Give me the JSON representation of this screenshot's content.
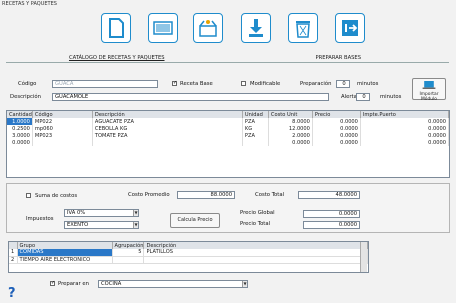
{
  "window": {
    "title": "RECETAS Y PAQUETES"
  },
  "toolbar": {
    "icons": [
      "new-document-icon",
      "barcode-icon",
      "package-icon",
      "download-icon",
      "delete-icon",
      "exit-icon"
    ]
  },
  "tabs": [
    "CATÁLOGO DE RECETAS Y PAQUETES",
    "PREPARAR BASES"
  ],
  "form": {
    "codigo_label": "Código",
    "codigo_value": "GUACA",
    "receta_base_label": "Receta Base",
    "receta_base_checked": true,
    "modificable_label": "Modificable",
    "modificable_checked": false,
    "preparacion_label": "Preparación",
    "preparacion_value": "0",
    "minutos1": "minutos",
    "descripcion_label": "Descripción",
    "descripcion_value": "GUACAMOLE",
    "alerta_label": "Alerta",
    "alerta_value": "0",
    "minutos2": "minutos",
    "import_label": "Importar Módulo"
  },
  "grid": {
    "headers": [
      "Cantidad",
      "Código",
      "Descripción",
      "Unidad",
      "Costo Unit",
      "Precio",
      "Impte.Puerto"
    ],
    "rows": [
      [
        "1.0000",
        "MP022",
        "AGUACATE PZA",
        "PZA",
        "8.0000",
        "0.0000",
        "0.0000"
      ],
      [
        "0.2500",
        "mp060",
        "CEBOLLA KG",
        "KG",
        "12.0000",
        "0.0000",
        "0.0000"
      ],
      [
        "3.0000",
        "MP023",
        "TOMATE PZA",
        "PZA",
        "2.0000",
        "0.0000",
        "0.0000"
      ],
      [
        "0.0000",
        "",
        "",
        "",
        "0.0000",
        "0.0000",
        "0.0000"
      ]
    ]
  },
  "costs": {
    "suma_label": "Suma de costos",
    "promedio_label": "Costo Promedio",
    "promedio_value": "88.0000",
    "total_label": "Costo Total",
    "total_value": "48.0000"
  },
  "taxes": {
    "impuestos_label": "Impuestos",
    "tax1": "IVA 0%",
    "tax2": "EXENTO",
    "calc_label": "Calcula Precio",
    "pglobal_label": "Precio Global",
    "pglobal_value": "0.0000",
    "ptotal_label": "Precio Total",
    "ptotal_value": "0.0000"
  },
  "groups": {
    "headers": [
      "Grupo",
      "Agrupación",
      "Descripción"
    ],
    "rows": [
      [
        "1",
        "COMIDAS",
        "5",
        "PLATILLOS"
      ],
      [
        "2",
        "TIEMPO AIRE ELECTRONICO",
        "",
        ""
      ]
    ]
  },
  "prep": {
    "label": "Preparar en",
    "checked": true,
    "value": "COCINA"
  },
  "help": {
    "glyph": "?"
  },
  "colors": {
    "accent": "#1f8ccc",
    "selection": "#2a78c8"
  }
}
